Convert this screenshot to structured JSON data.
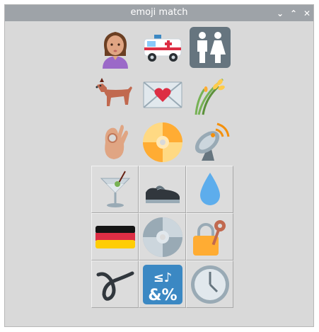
{
  "window": {
    "title": "emoji match"
  },
  "titlebar_buttons": {
    "minimize": "⌄",
    "maximize": "⌃",
    "close": "✕"
  },
  "grid": {
    "rows": [
      {
        "row": 1,
        "items": [
          {
            "icon": "woman-shrugging-emoji",
            "matched": true
          },
          {
            "icon": "ambulance-emoji",
            "matched": true
          },
          {
            "icon": "restroom-sign-emoji",
            "matched": true
          }
        ]
      },
      {
        "row": 2,
        "items": [
          {
            "icon": "dog-emoji",
            "matched": true
          },
          {
            "icon": "love-letter-emoji",
            "matched": true
          },
          {
            "icon": "rice-sheaf-emoji",
            "matched": true
          }
        ]
      },
      {
        "row": 3,
        "items": [
          {
            "icon": "ok-hand-emoji",
            "matched": true
          },
          {
            "icon": "dvd-emoji",
            "matched": true
          },
          {
            "icon": "satellite-antenna-emoji",
            "matched": true
          }
        ]
      },
      {
        "row": 4,
        "items": [
          {
            "icon": "cocktail-glass-emoji",
            "matched": false
          },
          {
            "icon": "shoe-emoji",
            "matched": false
          },
          {
            "icon": "droplet-emoji",
            "matched": false
          }
        ]
      },
      {
        "row": 5,
        "items": [
          {
            "icon": "germany-flag-emoji",
            "matched": false
          },
          {
            "icon": "optical-disc-emoji",
            "matched": false
          },
          {
            "icon": "locked-with-key-emoji",
            "matched": false
          }
        ]
      },
      {
        "row": 6,
        "items": [
          {
            "icon": "curly-loop-emoji",
            "matched": false
          },
          {
            "icon": "input-symbols-emoji",
            "matched": false
          },
          {
            "icon": "clock-emoji",
            "matched": false
          }
        ]
      }
    ]
  },
  "symbols_text": {
    "top": "≤♪",
    "bottom": "&%"
  },
  "colors": {
    "window_bg": "#d9d9d9",
    "titlebar_bg": "#9ea3a8",
    "symbol_tile": "#3b88c3",
    "droplet": "#5dadec",
    "clock_ring": "#99aab5"
  }
}
